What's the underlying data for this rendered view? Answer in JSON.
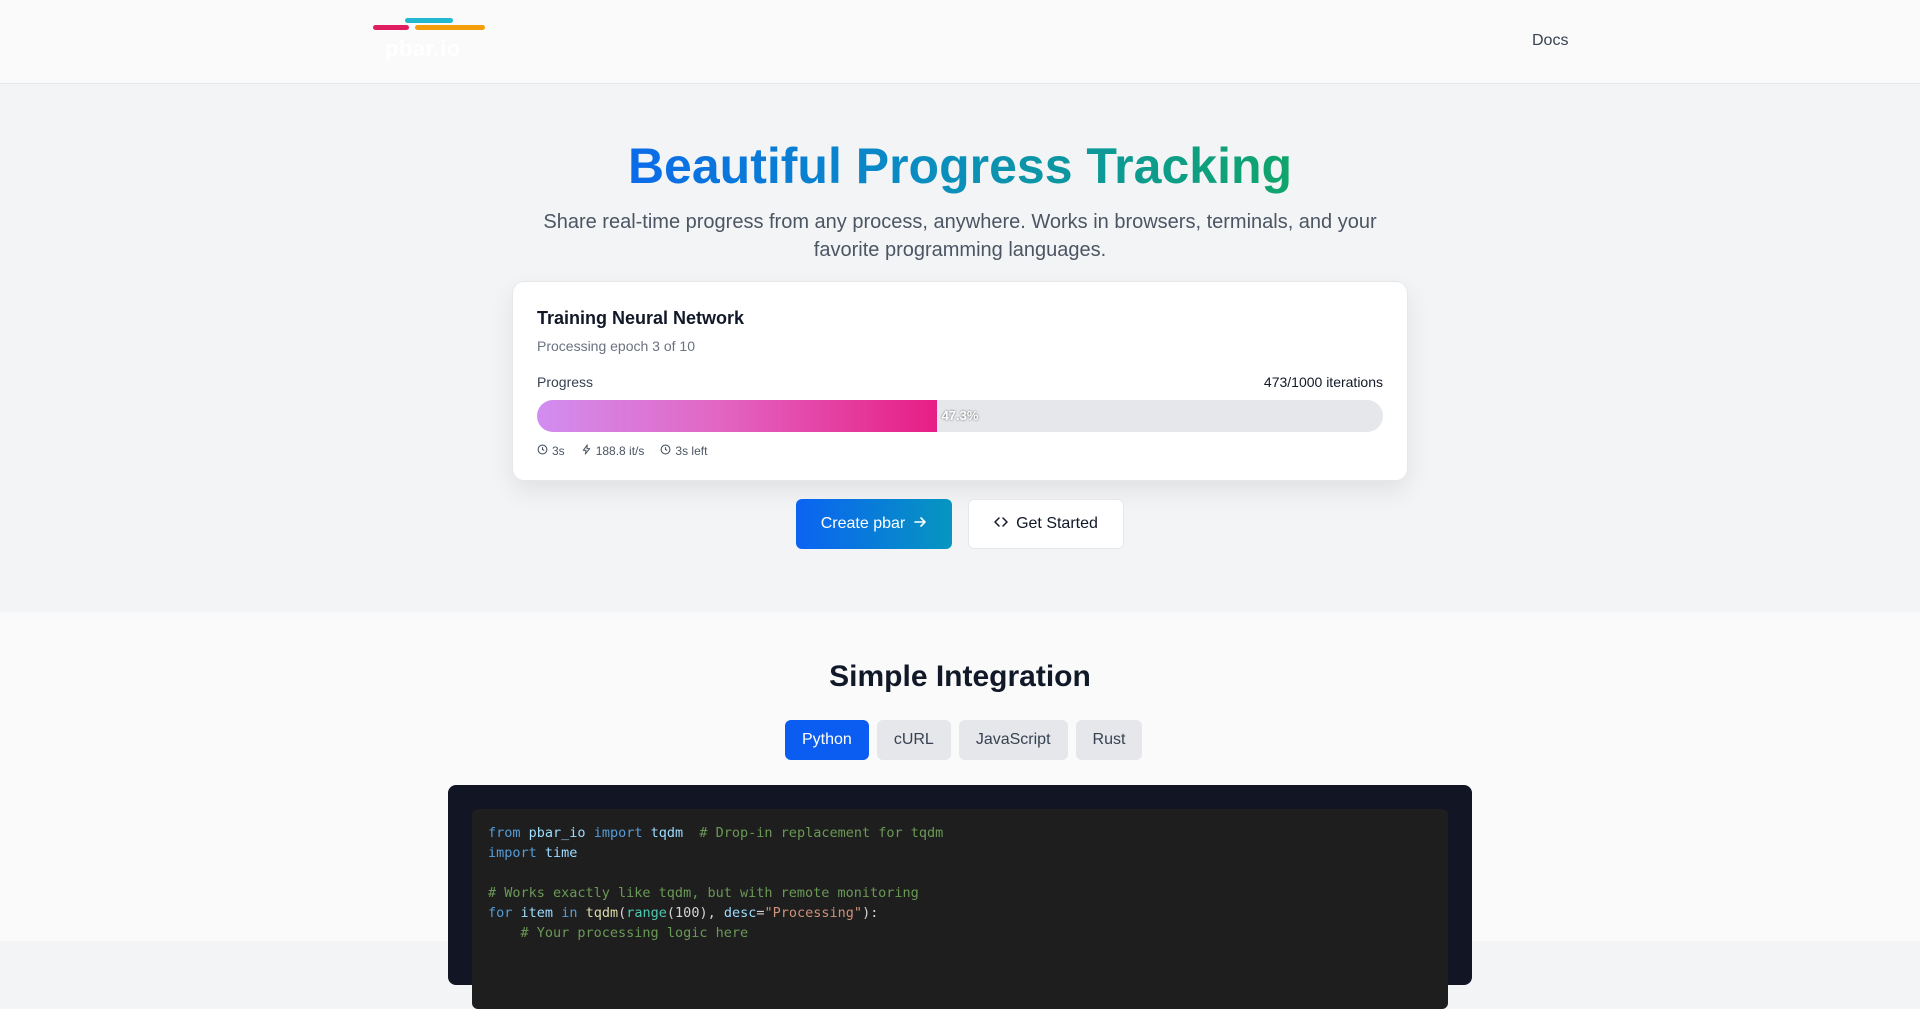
{
  "header": {
    "logo_text": "pbar.io",
    "logo_colors": [
      "#22b8cf",
      "#e11d62",
      "#f59e0b"
    ],
    "nav": {
      "docs_label": "Docs"
    }
  },
  "hero": {
    "title": "Beautiful Progress Tracking",
    "subtitle": "Share real-time progress from any process, anywhere. Works in browsers, terminals, and your favorite programming languages."
  },
  "demo_card": {
    "title": "Training Neural Network",
    "subtitle": "Processing epoch 3 of 10",
    "progress_label": "Progress",
    "count_label": "473/1000 iterations",
    "progress_fraction": 0.473,
    "percent_label": "47.3%",
    "stats": [
      {
        "icon": "clock-icon",
        "text": "3s"
      },
      {
        "icon": "zap-icon",
        "text": "188.8 it/s"
      },
      {
        "icon": "clock-icon",
        "text": "3s left"
      }
    ]
  },
  "actions": {
    "create_label": "Create pbar",
    "start_label": "Get Started"
  },
  "integration": {
    "title": "Simple Integration",
    "tabs": [
      {
        "label": "Python",
        "active": true
      },
      {
        "label": "cURL",
        "active": false
      },
      {
        "label": "JavaScript",
        "active": false
      },
      {
        "label": "Rust",
        "active": false
      }
    ],
    "code_lines": [
      "from pbar_io import tqdm  # Drop-in replacement for tqdm",
      "import time",
      "",
      "# Works exactly like tqdm, but with remote monitoring",
      "for item in tqdm(range(100), desc=\"Processing\"):",
      "    # Your processing logic here"
    ]
  },
  "colors": {
    "accent_blue": "#0b5cf0",
    "progress_start": "#d18ef0",
    "progress_end": "#e71e85"
  }
}
